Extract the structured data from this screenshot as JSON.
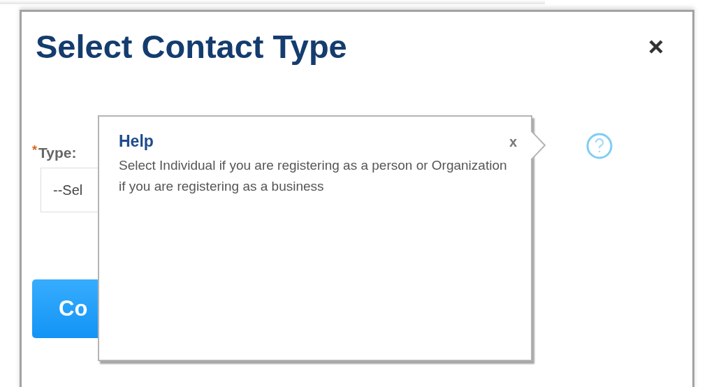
{
  "dialog": {
    "title": "Select Contact Type"
  },
  "form": {
    "required_mark": "*",
    "label": "Type:",
    "select_value": "--Sel",
    "button": "Co"
  },
  "help_popover": {
    "title": "Help",
    "close": "x",
    "text": "Select Individual if you are registering as a person or Organization if you are registering as a business"
  }
}
